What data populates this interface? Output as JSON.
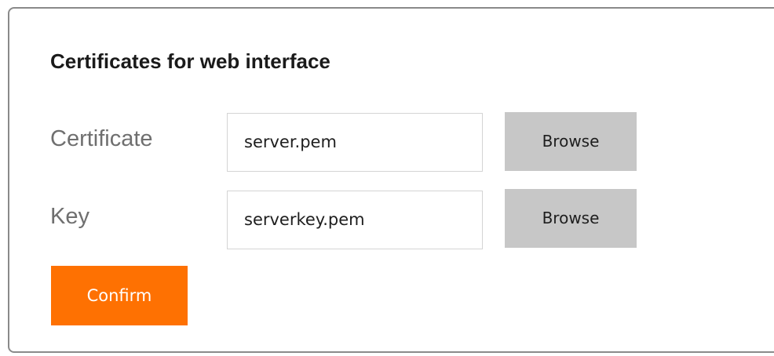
{
  "dialog": {
    "title": "Certificates for web interface"
  },
  "certificate": {
    "label": "Certificate",
    "value": "server.pem",
    "browse_label": "Browse"
  },
  "key": {
    "label": "Key",
    "value": "serverkey.pem",
    "browse_label": "Browse"
  },
  "actions": {
    "confirm_label": "Confirm"
  },
  "colors": {
    "accent": "#fe7102",
    "browse_button": "#c7c7c7",
    "panel_border": "#8a8a8a"
  }
}
